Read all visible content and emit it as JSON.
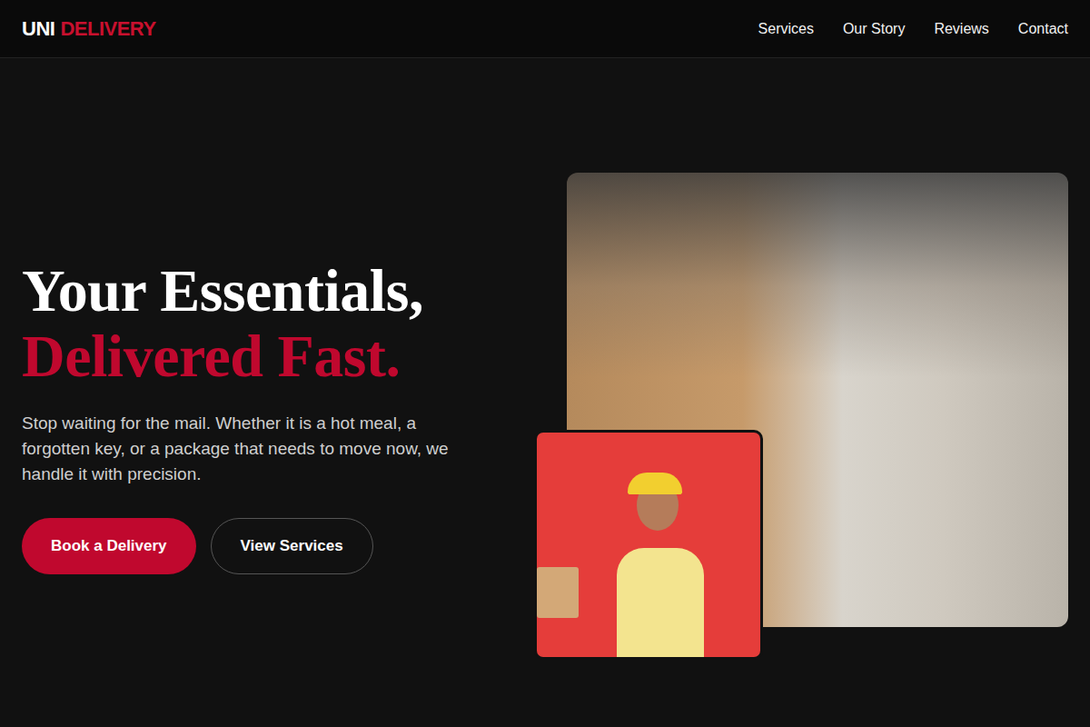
{
  "nav": {
    "logo": {
      "first": "UNI",
      "second": "DELIVERY"
    },
    "links": [
      "Services",
      "Our Story",
      "Reviews",
      "Contact"
    ]
  },
  "hero": {
    "title_line1": "Your Essentials,",
    "title_line2": "Delivered Fast.",
    "description": "Stop waiting for the mail. Whether it is a hot meal, a forgotten key, or a package that needs to move now, we handle it with precision.",
    "buttons": [
      {
        "label": "Book a Delivery",
        "kind": "primary"
      },
      {
        "label": "View Services",
        "kind": "secondary"
      }
    ]
  }
}
